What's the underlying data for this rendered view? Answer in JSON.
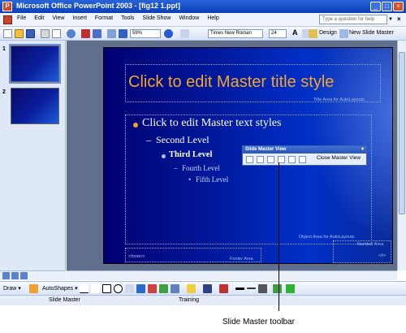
{
  "window": {
    "title": "Microsoft Office PowerPoint 2003 - [fig12 1.ppt]",
    "min": "_",
    "max": "□",
    "close": "×"
  },
  "menubar": {
    "items": [
      "File",
      "Edit",
      "View",
      "Insert",
      "Format",
      "Tools",
      "Slide Show",
      "Window",
      "Help"
    ],
    "help_placeholder": "Type a question for help",
    "help_dropdown": "▼",
    "close_doc": "×"
  },
  "toolbar": {
    "zoom": "59%",
    "font": "Times New Roman",
    "size": "24",
    "grow_font": "A",
    "design": "Design",
    "new_slide": "New Slide Master"
  },
  "thumbnails": [
    {
      "num": "1",
      "selected": true
    },
    {
      "num": "2",
      "selected": false
    }
  ],
  "slide": {
    "title": "Click to edit Master title style",
    "title_area_label": "Title Area for AutoLayouts",
    "levels": [
      "Click to edit Master text styles",
      "Second Level",
      "Third Level",
      "Fourth Level",
      "Fifth Level"
    ],
    "second_marker": "–",
    "fourth_marker": "–",
    "fifth_marker": "•",
    "object_area_label": "Object Area for AutoLayouts",
    "footer_date": "<footer>",
    "footer_area_label": "Footer Area",
    "number_area_label": "Number Area",
    "number_placeholder": "<#>",
    "bullet_color": "#f3a330",
    "title_color": "#f3a330"
  },
  "slide_master_toolbar": {
    "title": "Slide Master View",
    "close_label": "Close Master View",
    "close_x": "▾"
  },
  "drawbar": {
    "draw": "Draw ▾",
    "autoshapes": "AutoShapes ▾"
  },
  "statusbar": {
    "view": "Slide Master",
    "design": "Training"
  },
  "callout": "Slide Master toolbar"
}
